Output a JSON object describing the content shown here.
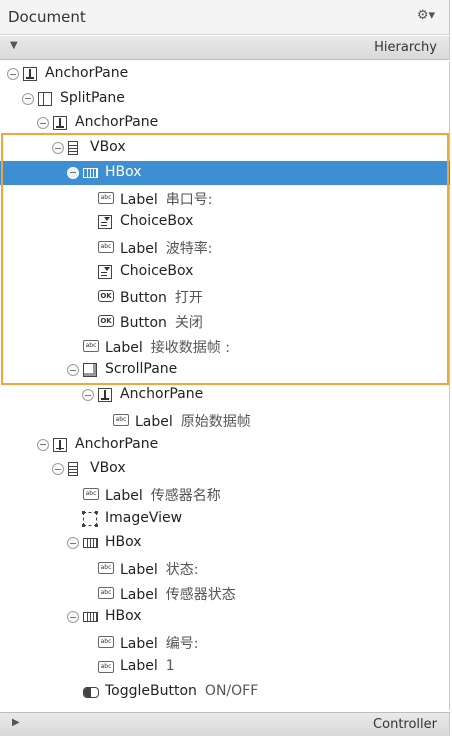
{
  "panel": {
    "title": "Document",
    "gear_glyph": "⚙▾"
  },
  "hierarchy": {
    "label": "Hierarchy",
    "arrow": "▼"
  },
  "controller": {
    "label": "Controller",
    "arrow": "▶"
  },
  "tree": [
    {
      "depth": 0,
      "toggle": true,
      "icon": "anchor",
      "type": "AnchorPane",
      "text": ""
    },
    {
      "depth": 1,
      "toggle": true,
      "icon": "split",
      "type": "SplitPane",
      "text": ""
    },
    {
      "depth": 2,
      "toggle": true,
      "icon": "anchor",
      "type": "AnchorPane",
      "text": ""
    },
    {
      "depth": 3,
      "toggle": true,
      "icon": "vbox",
      "type": "VBox",
      "text": ""
    },
    {
      "depth": 4,
      "toggle": true,
      "icon": "hbox",
      "type": "HBox",
      "text": "",
      "selected": true
    },
    {
      "depth": 5,
      "toggle": false,
      "icon": "label",
      "type": "Label",
      "text": "串口号:"
    },
    {
      "depth": 5,
      "toggle": false,
      "icon": "choice",
      "type": "ChoiceBox",
      "text": ""
    },
    {
      "depth": 5,
      "toggle": false,
      "icon": "label",
      "type": "Label",
      "text": "波特率:"
    },
    {
      "depth": 5,
      "toggle": false,
      "icon": "choice",
      "type": "ChoiceBox",
      "text": ""
    },
    {
      "depth": 5,
      "toggle": false,
      "icon": "button",
      "type": "Button",
      "text": "打开"
    },
    {
      "depth": 5,
      "toggle": false,
      "icon": "button",
      "type": "Button",
      "text": "关闭"
    },
    {
      "depth": 4,
      "toggle": false,
      "icon": "label",
      "type": "Label",
      "text": "接收数据帧 :"
    },
    {
      "depth": 4,
      "toggle": true,
      "icon": "scroll",
      "type": "ScrollPane",
      "text": ""
    },
    {
      "depth": 5,
      "toggle": true,
      "icon": "anchor",
      "type": "AnchorPane",
      "text": ""
    },
    {
      "depth": 6,
      "toggle": false,
      "icon": "label",
      "type": "Label",
      "text": "原始数据帧"
    },
    {
      "depth": 2,
      "toggle": true,
      "icon": "anchor",
      "type": "AnchorPane",
      "text": ""
    },
    {
      "depth": 3,
      "toggle": true,
      "icon": "vbox",
      "type": "VBox",
      "text": ""
    },
    {
      "depth": 4,
      "toggle": false,
      "icon": "label",
      "type": "Label",
      "text": "传感器名称"
    },
    {
      "depth": 4,
      "toggle": false,
      "icon": "image",
      "type": "ImageView",
      "text": ""
    },
    {
      "depth": 4,
      "toggle": true,
      "icon": "hbox",
      "type": "HBox",
      "text": ""
    },
    {
      "depth": 5,
      "toggle": false,
      "icon": "label",
      "type": "Label",
      "text": "状态:"
    },
    {
      "depth": 5,
      "toggle": false,
      "icon": "label",
      "type": "Label",
      "text": "传感器状态"
    },
    {
      "depth": 4,
      "toggle": true,
      "icon": "hbox",
      "type": "HBox",
      "text": ""
    },
    {
      "depth": 5,
      "toggle": false,
      "icon": "label",
      "type": "Label",
      "text": "编号:"
    },
    {
      "depth": 5,
      "toggle": false,
      "icon": "label",
      "type": "Label",
      "text": "1"
    },
    {
      "depth": 4,
      "toggle": false,
      "icon": "toggle",
      "type": "ToggleButton",
      "text": "ON/OFF"
    }
  ]
}
